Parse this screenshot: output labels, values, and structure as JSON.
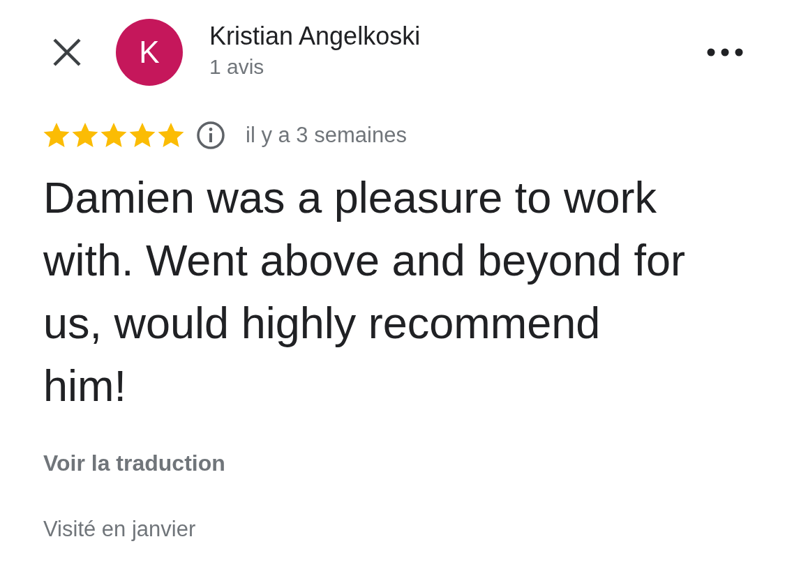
{
  "header": {
    "avatar_letter": "K",
    "name": "Kristian Angelkoski",
    "subtitle": "1 avis"
  },
  "review": {
    "stars": 5,
    "time": "il y a 3 semaines",
    "text": "Damien was a pleasure to work with. Went above and beyond for us, would highly recommend him!",
    "translate_link": "Voir la traduction",
    "visited": "Visité en janvier"
  }
}
